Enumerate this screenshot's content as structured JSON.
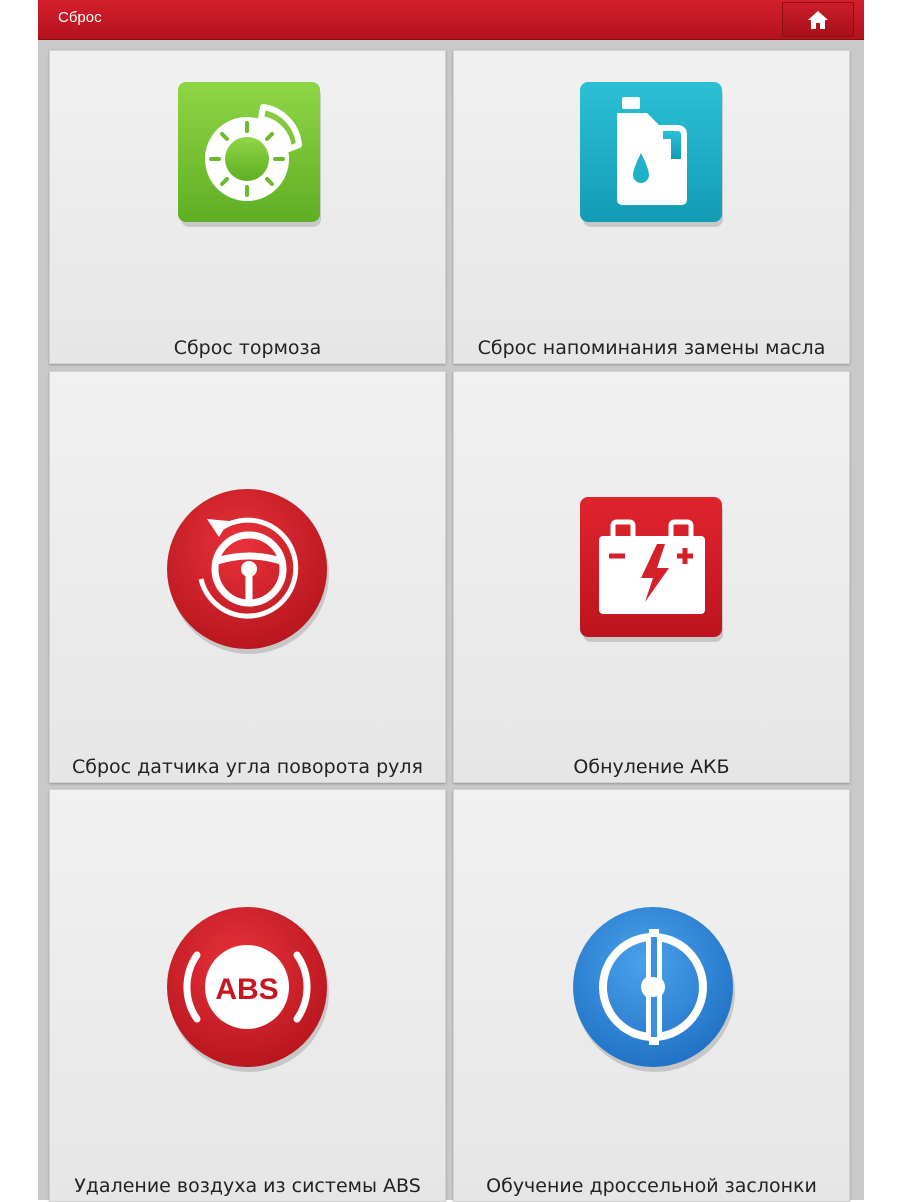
{
  "header": {
    "title": "Сброс",
    "home_icon": "home-icon"
  },
  "tiles": [
    {
      "label": "Сброс тормоза",
      "icon": "brake-disc-icon",
      "color": "#7cc83a"
    },
    {
      "label": "Сброс напоминания замены масла",
      "icon": "oil-canister-icon",
      "color": "#1eb1c9"
    },
    {
      "label": "Сброс датчика угла поворота руля",
      "icon": "steering-wheel-icon",
      "color": "#d4202a"
    },
    {
      "label": "Обнуление АКБ",
      "icon": "battery-icon",
      "color": "#d4202a"
    },
    {
      "label": "Удаление воздуха из системы ABS",
      "icon": "abs-icon",
      "icon_text": "ABS",
      "color": "#d4202a"
    },
    {
      "label": "Обучение дроссельной заслонки",
      "icon": "throttle-icon",
      "color": "#2f86d8"
    }
  ],
  "colors": {
    "header": "#c8161f",
    "tile_bg": "#ececec"
  }
}
